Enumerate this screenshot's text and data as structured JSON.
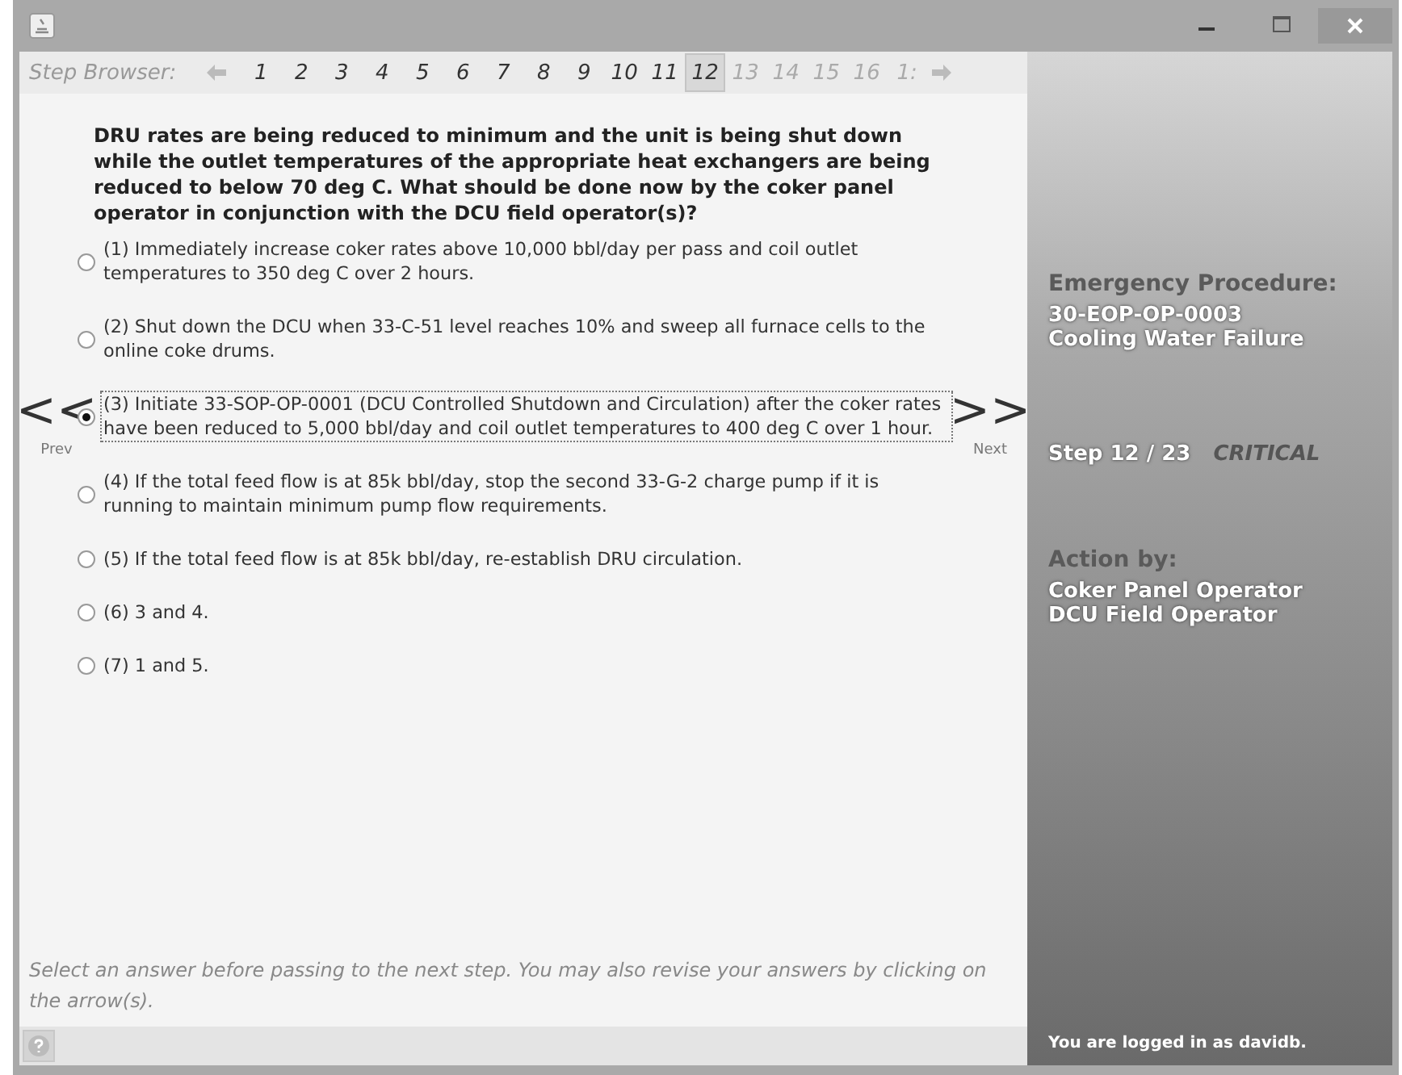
{
  "step_browser": {
    "label": "Step Browser:",
    "steps": [
      {
        "label": "1",
        "selected": false,
        "disabled": false
      },
      {
        "label": "2",
        "selected": false,
        "disabled": false
      },
      {
        "label": "3",
        "selected": false,
        "disabled": false
      },
      {
        "label": "4",
        "selected": false,
        "disabled": false
      },
      {
        "label": "5",
        "selected": false,
        "disabled": false
      },
      {
        "label": "6",
        "selected": false,
        "disabled": false
      },
      {
        "label": "7",
        "selected": false,
        "disabled": false
      },
      {
        "label": "8",
        "selected": false,
        "disabled": false
      },
      {
        "label": "9",
        "selected": false,
        "disabled": false
      },
      {
        "label": "10",
        "selected": false,
        "disabled": false
      },
      {
        "label": "11",
        "selected": false,
        "disabled": false
      },
      {
        "label": "12",
        "selected": true,
        "disabled": false
      },
      {
        "label": "13",
        "selected": false,
        "disabled": true
      },
      {
        "label": "14",
        "selected": false,
        "disabled": true
      },
      {
        "label": "15",
        "selected": false,
        "disabled": true
      },
      {
        "label": "16",
        "selected": false,
        "disabled": true
      },
      {
        "label": "1:",
        "selected": false,
        "disabled": true
      }
    ]
  },
  "question": "DRU rates are being reduced to minimum and the unit is being shut down while the outlet temperatures of the appropriate heat exchangers are being reduced to below 70 deg C. What should be done now by the coker panel operator in conjunction with the DCU field operator(s)?",
  "options": [
    {
      "text": "(1) Immediately increase coker rates above 10,000 bbl/day per pass and coil outlet temperatures to 350 deg C over 2 hours.",
      "selected": false,
      "focused": false
    },
    {
      "text": "(2) Shut down the DCU when 33-C-51 level reaches 10% and sweep all furnace cells to the online coke drums.",
      "selected": false,
      "focused": false
    },
    {
      "text": "(3) Initiate 33-SOP-OP-0001 (DCU Controlled Shutdown and Circulation) after the coker rates have been reduced to 5,000 bbl/day and coil outlet temperatures to 400 deg C over 1 hour.",
      "selected": true,
      "focused": true
    },
    {
      "text": "(4) If the total feed flow is at 85k bbl/day, stop the second 33-G-2 charge pump if it is running to maintain minimum pump flow requirements.",
      "selected": false,
      "focused": false
    },
    {
      "text": "(5) If the total feed flow is at 85k bbl/day, re-establish DRU circulation.",
      "selected": false,
      "focused": false
    },
    {
      "text": "(6) 3 and 4.",
      "selected": false,
      "focused": false
    },
    {
      "text": "(7) 1 and 5.",
      "selected": false,
      "focused": false
    }
  ],
  "prev": {
    "arrow": "<<",
    "label": "Prev"
  },
  "next": {
    "arrow": ">>",
    "label": "Next"
  },
  "hint": "Select an answer before passing to the next step. You may also revise your answers by clicking on the arrow(s).",
  "side_panel": {
    "procedure_label": "Emergency Procedure:",
    "procedure_id": "30-EOP-OP-0003",
    "procedure_name": "Cooling Water Failure",
    "step": "Step 12 / 23",
    "severity": "CRITICAL",
    "action_label": "Action by:",
    "actors": [
      "Coker Panel Operator",
      "DCU Field Operator"
    ],
    "login": "You are logged in as davidb."
  }
}
